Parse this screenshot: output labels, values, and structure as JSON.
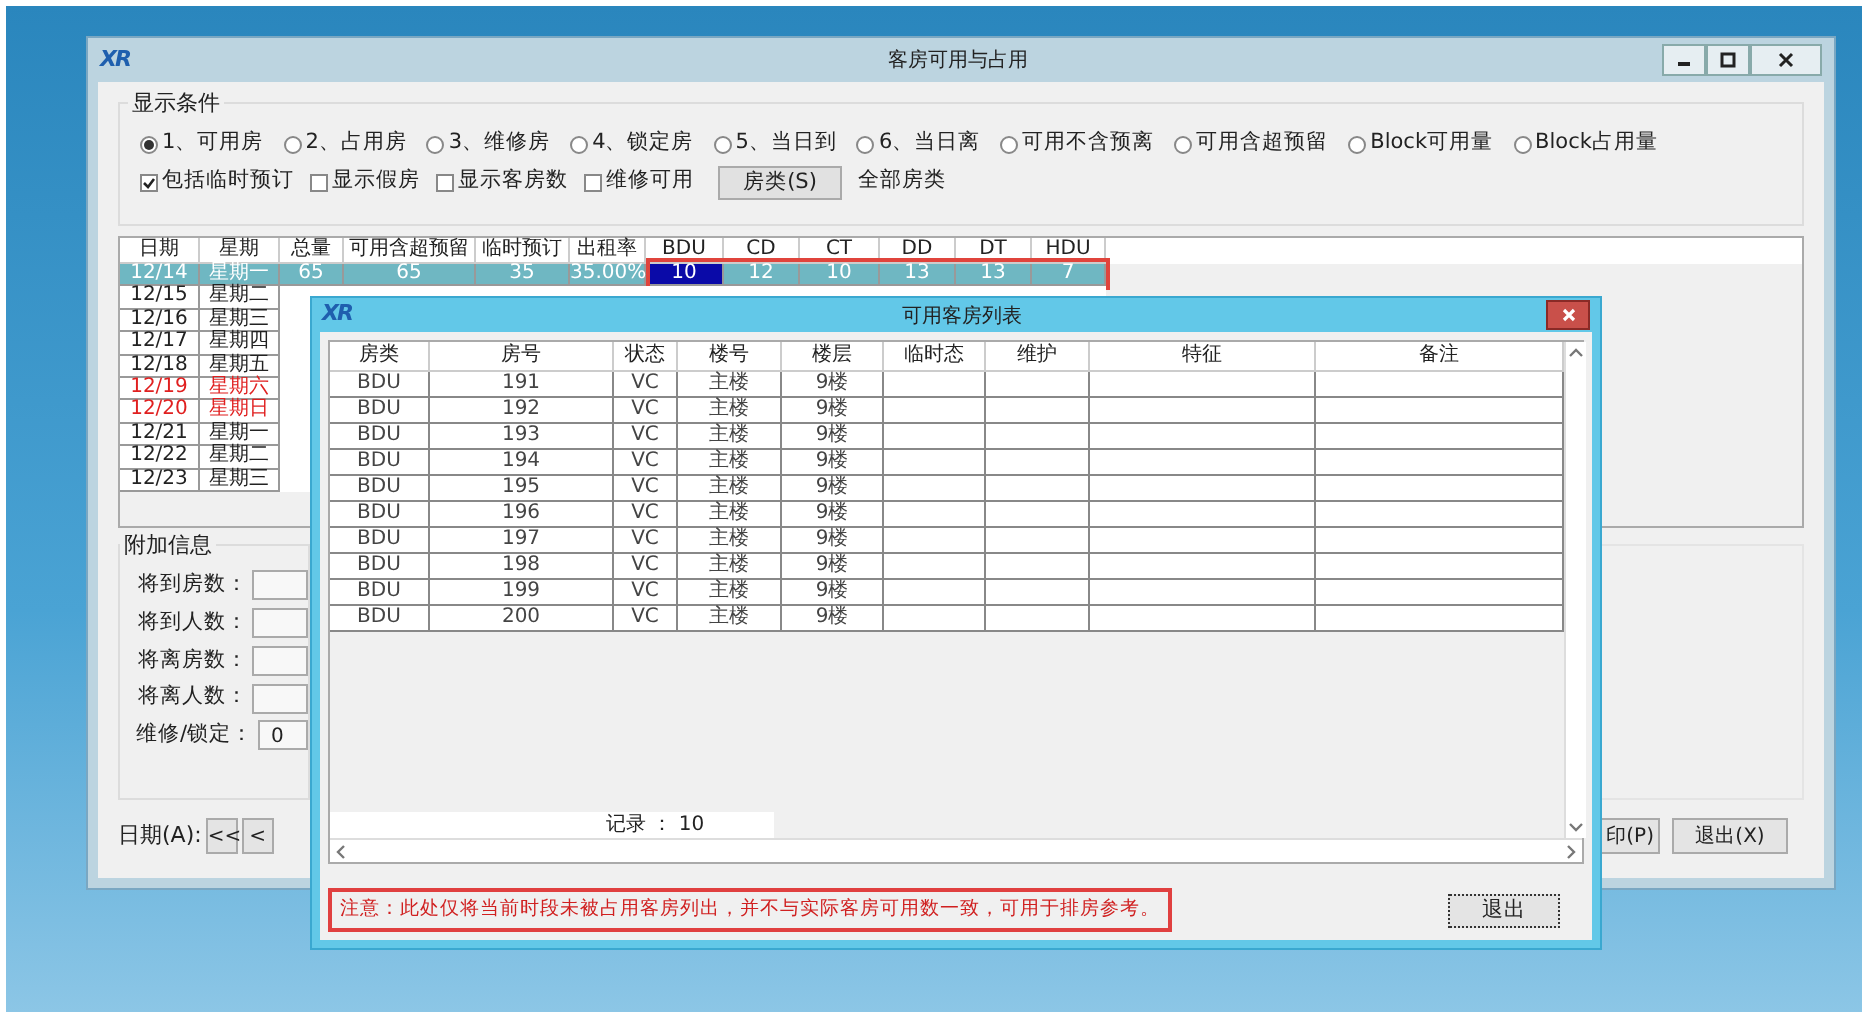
{
  "main_window": {
    "logo": "XR",
    "title": "客房可用与占用",
    "display_conditions": {
      "title": "显示条件",
      "radios": [
        {
          "label": "1、可用房",
          "selected": true
        },
        {
          "label": "2、占用房",
          "selected": false
        },
        {
          "label": "3、维修房",
          "selected": false
        },
        {
          "label": "4、锁定房",
          "selected": false
        },
        {
          "label": "5、当日到",
          "selected": false
        },
        {
          "label": "6、当日离",
          "selected": false
        },
        {
          "label": "可用不含预离",
          "selected": false
        },
        {
          "label": "可用含超预留",
          "selected": false
        },
        {
          "label": "Block可用量",
          "selected": false
        },
        {
          "label": "Block占用量",
          "selected": false
        }
      ],
      "checkboxes": [
        {
          "label": "包括临时预订",
          "checked": true
        },
        {
          "label": "显示假房",
          "checked": false
        },
        {
          "label": "显示客房数",
          "checked": false
        },
        {
          "label": "维修可用",
          "checked": false
        }
      ],
      "room_type_button": "房类(S)",
      "room_type_value": "全部房类"
    },
    "grid": {
      "columns": [
        "日期",
        "星期",
        "总量",
        "可用含超预留",
        "临时预订",
        "出租率",
        "BDU",
        "CD",
        "CT",
        "DD",
        "DT",
        "HDU"
      ],
      "outlined": true,
      "rows": [
        {
          "selected": true,
          "weekend": false,
          "cells": [
            {
              "text": "12/14",
              "focused": false
            },
            {
              "text": "星期一",
              "focused": false
            },
            {
              "text": "65",
              "focused": false
            },
            {
              "text": "65",
              "focused": false
            },
            {
              "text": "35",
              "focused": false
            },
            {
              "text": "35.00%",
              "focused": false
            },
            {
              "text": "10",
              "focused": true
            },
            {
              "text": "12",
              "focused": false
            },
            {
              "text": "10",
              "focused": false
            },
            {
              "text": "13",
              "focused": false
            },
            {
              "text": "13",
              "focused": false
            },
            {
              "text": "7",
              "focused": false
            }
          ]
        },
        {
          "selected": false,
          "weekend": false,
          "cells": [
            {
              "text": "12/15",
              "focused": false
            },
            {
              "text": "星期二",
              "focused": false
            }
          ]
        },
        {
          "selected": false,
          "weekend": false,
          "cells": [
            {
              "text": "12/16",
              "focused": false
            },
            {
              "text": "星期三",
              "focused": false
            }
          ]
        },
        {
          "selected": false,
          "weekend": false,
          "cells": [
            {
              "text": "12/17",
              "focused": false
            },
            {
              "text": "星期四",
              "focused": false
            }
          ]
        },
        {
          "selected": false,
          "weekend": false,
          "cells": [
            {
              "text": "12/18",
              "focused": false
            },
            {
              "text": "星期五",
              "focused": false
            }
          ]
        },
        {
          "selected": false,
          "weekend": true,
          "cells": [
            {
              "text": "12/19",
              "focused": false
            },
            {
              "text": "星期六",
              "focused": false
            }
          ]
        },
        {
          "selected": false,
          "weekend": true,
          "cells": [
            {
              "text": "12/20",
              "focused": false
            },
            {
              "text": "星期日",
              "focused": false
            }
          ]
        },
        {
          "selected": false,
          "weekend": false,
          "cells": [
            {
              "text": "12/21",
              "focused": false
            },
            {
              "text": "星期一",
              "focused": false
            }
          ]
        },
        {
          "selected": false,
          "weekend": false,
          "cells": [
            {
              "text": "12/22",
              "focused": false
            },
            {
              "text": "星期二",
              "focused": false
            }
          ]
        },
        {
          "selected": false,
          "weekend": false,
          "cells": [
            {
              "text": "12/23",
              "focused": false
            },
            {
              "text": "星期三",
              "focused": false
            }
          ]
        }
      ]
    },
    "additional_info": {
      "title": "附加信息",
      "fields": [
        {
          "label": "将到房数："
        },
        {
          "label": "将到人数："
        },
        {
          "label": "将离房数："
        },
        {
          "label": "将离人数："
        },
        {
          "label": "维修/锁定：",
          "value": "0"
        }
      ]
    },
    "bottom_bar": {
      "date_label": "日期(A):",
      "nav_buttons": [
        "<<",
        "<"
      ],
      "print_button": "印(P)",
      "exit_button": "退出(X)"
    }
  },
  "dialog": {
    "logo": "XR",
    "title": "可用客房列表",
    "columns": [
      "房类",
      "房号",
      "状态",
      "楼号",
      "楼层",
      "临时态",
      "维护",
      "特征",
      "备注"
    ],
    "rows": [
      [
        "BDU",
        "191",
        "VC",
        "主楼",
        "9楼"
      ],
      [
        "BDU",
        "192",
        "VC",
        "主楼",
        "9楼"
      ],
      [
        "BDU",
        "193",
        "VC",
        "主楼",
        "9楼"
      ],
      [
        "BDU",
        "194",
        "VC",
        "主楼",
        "9楼"
      ],
      [
        "BDU",
        "195",
        "VC",
        "主楼",
        "9楼"
      ],
      [
        "BDU",
        "196",
        "VC",
        "主楼",
        "9楼"
      ],
      [
        "BDU",
        "197",
        "VC",
        "主楼",
        "9楼"
      ],
      [
        "BDU",
        "198",
        "VC",
        "主楼",
        "9楼"
      ],
      [
        "BDU",
        "199",
        "VC",
        "主楼",
        "9楼"
      ],
      [
        "BDU",
        "200",
        "VC",
        "主楼",
        "9楼"
      ]
    ],
    "record_count": "记录 ： 10",
    "notice": "注意：此处仅将当前时段未被占用客房列出，并不与实际客房可用数一致，可用于排房参考。",
    "exit_button": "退出"
  }
}
